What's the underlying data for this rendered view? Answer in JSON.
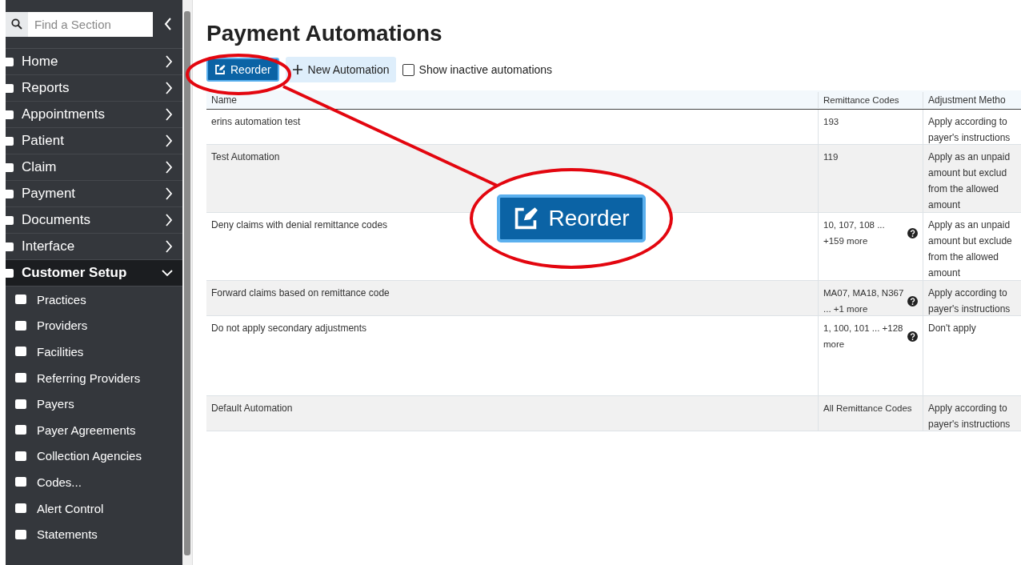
{
  "sidebar": {
    "search": {
      "placeholder": "Find a Section"
    },
    "items": [
      {
        "label": "Home",
        "expanded": false
      },
      {
        "label": "Reports",
        "expanded": false
      },
      {
        "label": "Appointments",
        "expanded": false
      },
      {
        "label": "Patient",
        "expanded": false
      },
      {
        "label": "Claim",
        "expanded": false
      },
      {
        "label": "Payment",
        "expanded": false
      },
      {
        "label": "Documents",
        "expanded": false
      },
      {
        "label": "Interface",
        "expanded": false
      },
      {
        "label": "Customer Setup",
        "expanded": true,
        "children": [
          {
            "label": "Practices"
          },
          {
            "label": "Providers"
          },
          {
            "label": "Facilities"
          },
          {
            "label": "Referring Providers"
          },
          {
            "label": "Payers"
          },
          {
            "label": "Payer Agreements"
          },
          {
            "label": "Collection Agencies"
          },
          {
            "label": "Codes..."
          },
          {
            "label": "Alert Control"
          },
          {
            "label": "Statements"
          }
        ]
      }
    ]
  },
  "page": {
    "title": "Payment Automations"
  },
  "toolbar": {
    "reorder": "Reorder",
    "new_automation": "New Automation",
    "show_inactive": {
      "label": "Show inactive automations",
      "checked": false
    }
  },
  "table": {
    "columns": [
      "Name",
      "Remittance Codes",
      "Adjustment Metho"
    ],
    "rows": [
      {
        "name": "erins automation test",
        "codes": "193",
        "help": false,
        "method": [
          "Apply according to",
          "payer's instructions"
        ]
      },
      {
        "name": "Test Automation",
        "codes": "119",
        "help": false,
        "method": [
          "Apply as an unpaid",
          "amount but exclud",
          "from the allowed",
          "amount"
        ]
      },
      {
        "name": "Deny claims with denial remittance codes",
        "codes": "10, 107, 108 ... +159 more",
        "help": true,
        "method": [
          "Apply as an unpaid",
          "amount but exclude",
          "from the allowed",
          "amount"
        ]
      },
      {
        "name": "Forward claims based on remittance code",
        "codes": "MA07, MA18, N367 ... +1 more",
        "help": true,
        "method": [
          "Apply according to",
          "payer's instructions"
        ]
      },
      {
        "name": "Do not apply secondary adjustments",
        "codes": "1, 100, 101 ... +128 more",
        "help": true,
        "method": [
          "Don't apply"
        ]
      },
      {
        "name": "Default Automation",
        "codes": "All Remittance Codes",
        "help": false,
        "method": [
          "Apply according to",
          "payer's instructions"
        ]
      }
    ]
  },
  "callout": {
    "label": "Reorder"
  }
}
